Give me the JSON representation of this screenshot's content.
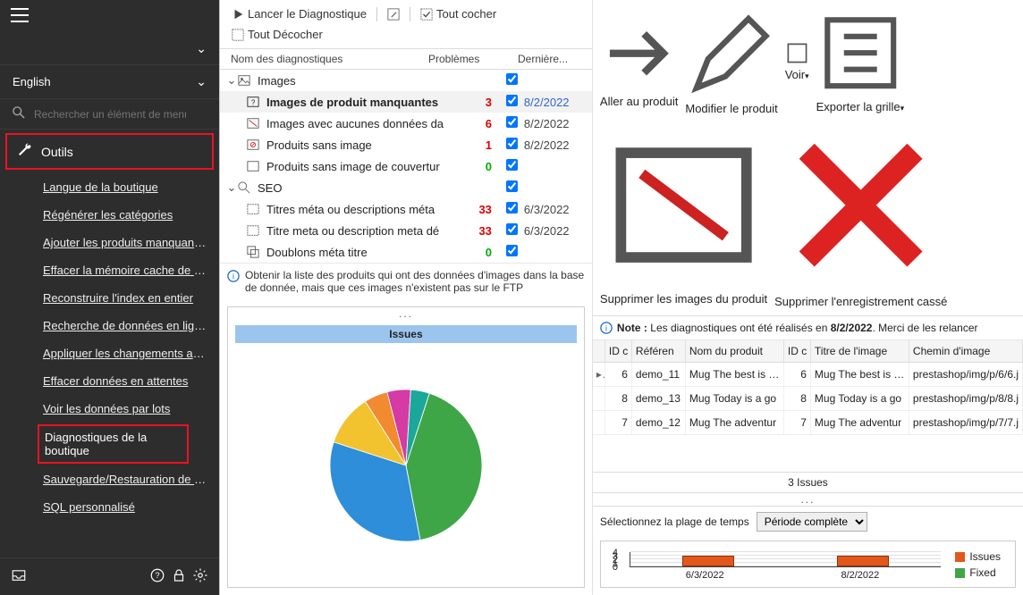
{
  "sidebar": {
    "blank_section": "",
    "language": "English",
    "search_placeholder": "Rechercher un élément de menu",
    "outils_label": "Outils",
    "items": [
      "Langue de la boutique",
      "Régénérer les catégories",
      "Ajouter les produits manquants ...",
      "Effacer la mémoire cache de la b...",
      "Reconstruire l'index en entier",
      "Recherche de données en ligne",
      "Appliquer les changements au W...",
      "Effacer données en attentes",
      "Voir les données par lots",
      "Diagnostiques de la boutique",
      "Sauvegarde/Restauration de la b...",
      "SQL personnalisé"
    ]
  },
  "mid_toolbar": {
    "launch": "Lancer le Diagnostique",
    "check_all": "Tout cocher",
    "uncheck_all": "Tout Décocher"
  },
  "mid_grid_head": {
    "c1": "Nom des diagnostiques",
    "c2": "Problèmes",
    "c4": "Dernière..."
  },
  "tree": {
    "images": {
      "label": "Images"
    },
    "img_missing": {
      "label": "Images de produit manquantes",
      "num": "3",
      "date": "8/2/2022"
    },
    "img_nodata": {
      "label": "Images avec aucunes données da",
      "num": "6",
      "date": "8/2/2022"
    },
    "prod_noimg": {
      "label": "Produits sans image",
      "num": "1",
      "date": "8/2/2022"
    },
    "prod_nocover": {
      "label": "Produits sans image de couvertur",
      "num": "0"
    },
    "seo": {
      "label": "SEO"
    },
    "meta_titles": {
      "label": "Titres méta ou descriptions méta",
      "num": "33",
      "date": "6/3/2022"
    },
    "meta_title_def": {
      "label": "Titre meta ou description meta dé",
      "num": "33",
      "date": "6/3/2022"
    },
    "meta_dup": {
      "label": "Doublons méta titre",
      "num": "0"
    }
  },
  "info_text": "Obtenir la liste des produits qui ont des données d'images dans la base de donnée, mais que ces images n'existent pas sur le FTP",
  "issues_title": "Issues",
  "right_toolbar": {
    "goto": "Aller au produit",
    "edit": "Modifier le produit",
    "view": "Voir",
    "export": "Exporter la grille",
    "del_img": "Supprimer les images du produit",
    "del_rec": "Supprimer l'enregistrement cassé"
  },
  "note": {
    "prefix": "Note :",
    "text": "Les diagnostiques ont été réalisés en",
    "date": "8/2/2022",
    "suffix": ". Merci de les relancer"
  },
  "rgrid_head": {
    "id1": "ID c",
    "ref": "Référen",
    "pn": "Nom du produit",
    "id2": "ID c",
    "ti": "Titre de l'image",
    "cp": "Chemin d'image"
  },
  "rgrid_rows": [
    {
      "id1": "6",
      "ref": "demo_11",
      "pn": "Mug The best is ye",
      "id2": "6",
      "ti": "Mug The best is ye",
      "cp": "prestashop/img/p/6/6.j"
    },
    {
      "id1": "8",
      "ref": "demo_13",
      "pn": "Mug Today is a go",
      "id2": "8",
      "ti": "Mug Today is a go",
      "cp": "prestashop/img/p/8/8.j"
    },
    {
      "id1": "7",
      "ref": "demo_12",
      "pn": "Mug The adventur",
      "id2": "7",
      "ti": "Mug The adventur",
      "cp": "prestashop/img/p/7/7.j"
    }
  ],
  "issues_summary": "3 Issues",
  "time_label": "Sélectionnez la plage de temps",
  "time_value": "Période complète",
  "legend": {
    "issues": "Issues",
    "fixed": "Fixed"
  },
  "chart_data": [
    {
      "type": "pie",
      "title": "Issues",
      "series": [
        {
          "name": "green",
          "value": 42,
          "color": "#3fa648"
        },
        {
          "name": "blue",
          "value": 33,
          "color": "#2e8eda"
        },
        {
          "name": "yellow",
          "value": 11,
          "color": "#f2c22f"
        },
        {
          "name": "orange",
          "value": 5,
          "color": "#f28a2f"
        },
        {
          "name": "magenta",
          "value": 5,
          "color": "#d63aa4"
        },
        {
          "name": "teal",
          "value": 4,
          "color": "#1aa89a"
        }
      ]
    },
    {
      "type": "bar",
      "categories": [
        "6/3/2022",
        "8/2/2022"
      ],
      "series": [
        {
          "name": "Issues",
          "values": [
            3,
            3
          ],
          "color": "#e3581a"
        },
        {
          "name": "Fixed",
          "values": [
            0,
            0
          ],
          "color": "#3fa648"
        }
      ],
      "ylim": [
        0,
        4
      ],
      "yticks": [
        0,
        1,
        2,
        3,
        4
      ]
    }
  ]
}
